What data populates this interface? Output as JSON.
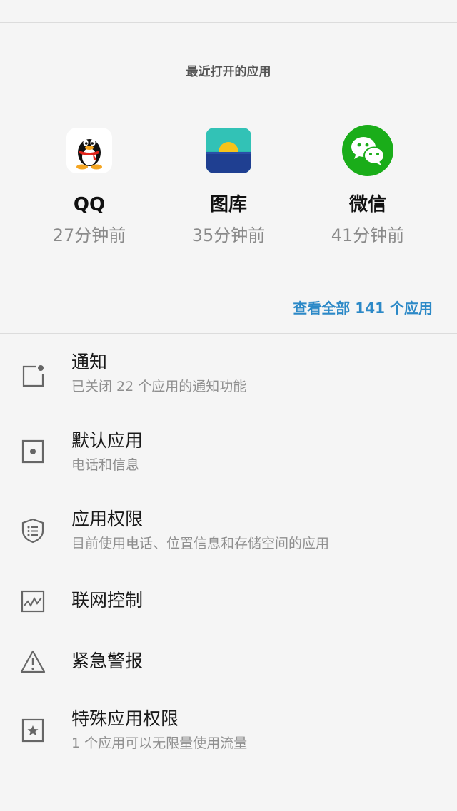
{
  "recent": {
    "title": "最近打开的应用",
    "apps": [
      {
        "name": "QQ",
        "time": "27分钟前",
        "icon": "qq-penguin-icon"
      },
      {
        "name": "图库",
        "time": "35分钟前",
        "icon": "gallery-icon"
      },
      {
        "name": "微信",
        "time": "41分钟前",
        "icon": "wechat-icon"
      }
    ],
    "see_all": "查看全部 141 个应用"
  },
  "settings": [
    {
      "title": "通知",
      "subtitle": "已关闭 22 个应用的通知功能",
      "icon": "notification-icon"
    },
    {
      "title": "默认应用",
      "subtitle": "电话和信息",
      "icon": "default-app-icon"
    },
    {
      "title": "应用权限",
      "subtitle": "目前使用电话、位置信息和存储空间的应用",
      "icon": "shield-icon"
    },
    {
      "title": "联网控制",
      "icon": "network-graph-icon"
    },
    {
      "title": "紧急警报",
      "icon": "warning-icon"
    },
    {
      "title": "特殊应用权限",
      "subtitle": "1 个应用可以无限量使用流量",
      "icon": "star-box-icon"
    }
  ],
  "colors": {
    "accent": "#2c89c7",
    "background": "#f5f5f5",
    "wechat_green": "#1aad19"
  }
}
